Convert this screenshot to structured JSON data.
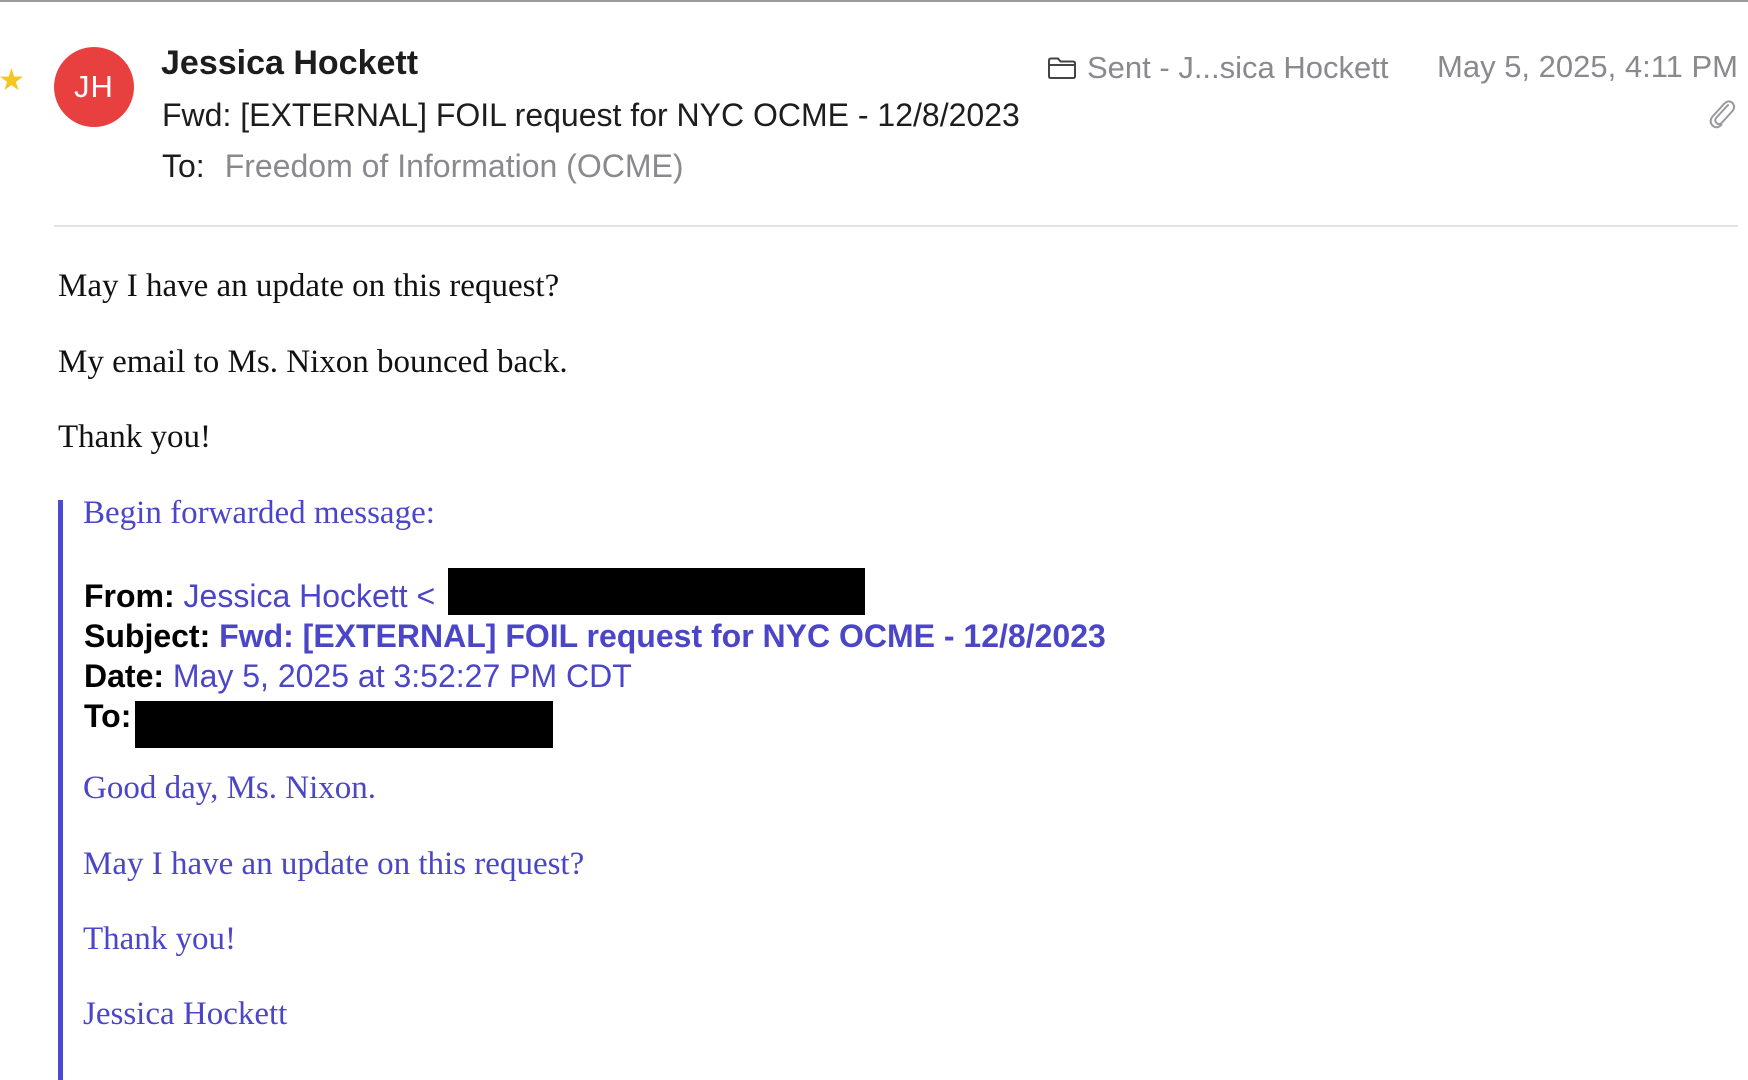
{
  "message": {
    "flagged_icon": "star-icon",
    "avatar_initials": "JH",
    "avatar_color": "#e8403f",
    "sender_name": "Jessica Hockett",
    "subject": "Fwd: [EXTERNAL] FOIL request for NYC OCME - 12/8/2023",
    "to_label": "To:",
    "to_value": "Freedom of Information (OCME)",
    "folder_icon": "folder-icon",
    "folder": "Sent - J...sica Hockett",
    "date": "May 5, 2025, 4:11 PM",
    "attachment_icon": "paperclip-icon"
  },
  "body": {
    "lines": [
      "May I have an update on this request?",
      "My email to Ms. Nixon bounced back.",
      "Thank you!"
    ]
  },
  "forwarded": {
    "intro": "Begin forwarded message:",
    "from_label": "From:",
    "from_value": "Jessica Hockett <",
    "subject_label": "Subject:",
    "subject_value": "Fwd: [EXTERNAL] FOIL request for NYC OCME - 12/8/2023",
    "date_label": "Date:",
    "date_value": "May 5, 2025 at 3:52:27 PM CDT",
    "to_label": "To:",
    "body_lines": [
      "Good day, Ms. Nixon.",
      "May I have an update on this request?",
      "Thank you!",
      "Jessica Hockett"
    ],
    "quote_color": "#4b45c8"
  }
}
